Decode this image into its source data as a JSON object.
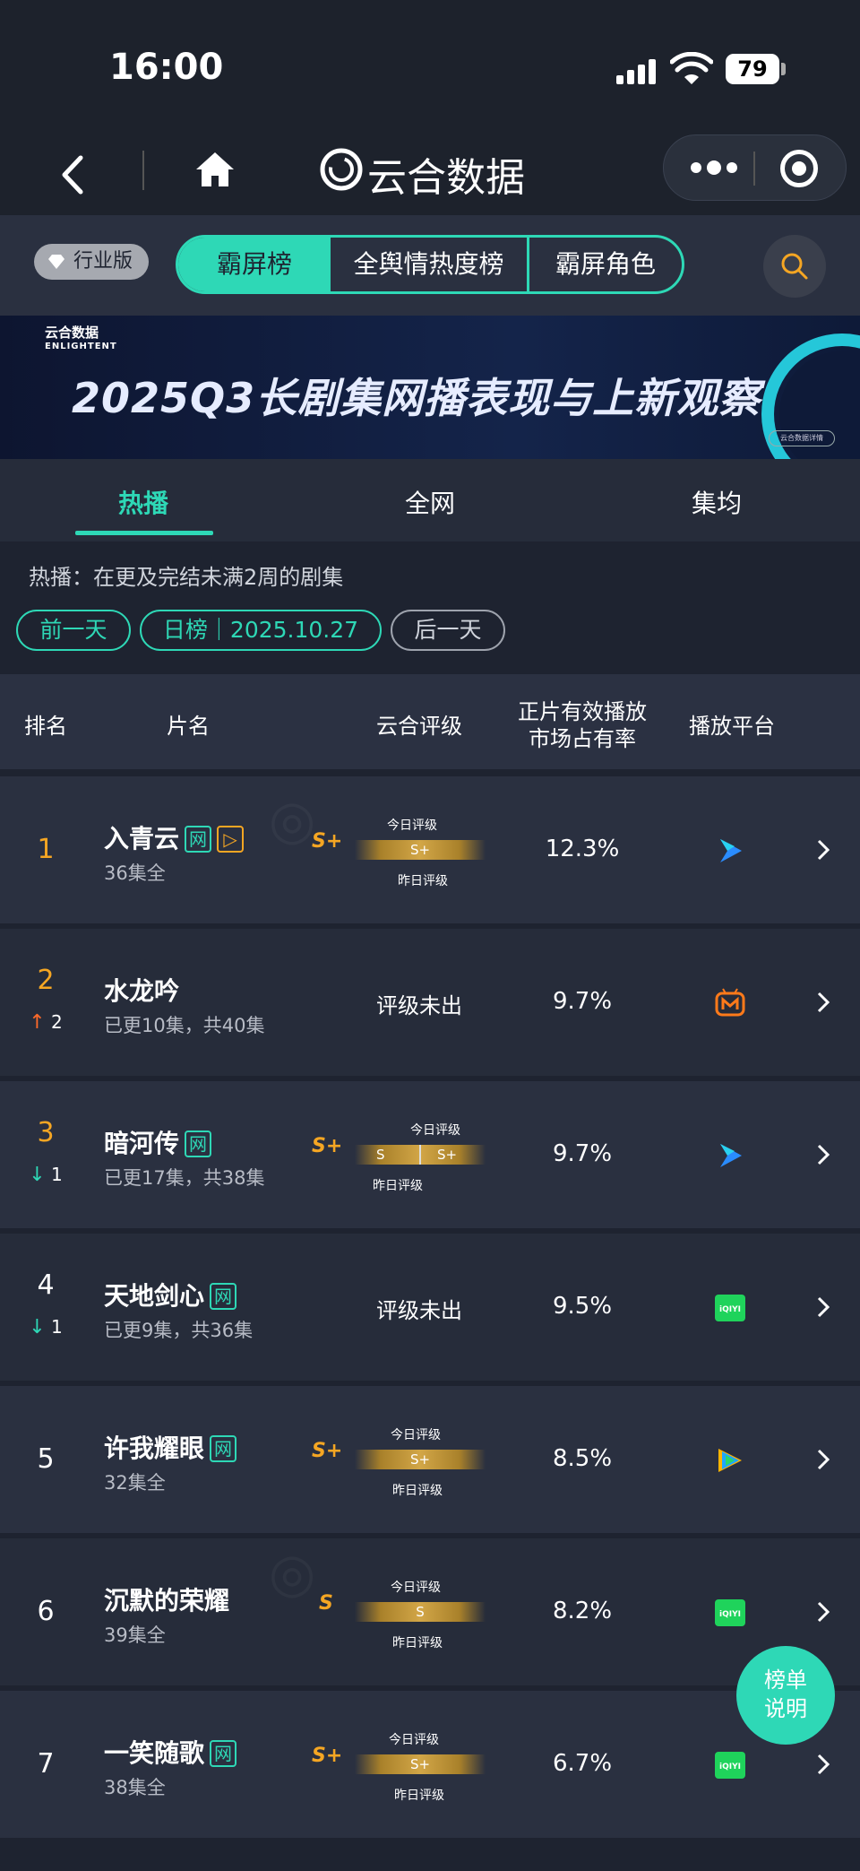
{
  "status": {
    "time": "16:00",
    "battery": "79"
  },
  "nav": {
    "brand": "云合数据"
  },
  "filter": {
    "edition_badge": "行业版",
    "segments": [
      "霸屏榜",
      "全舆情热度榜",
      "霸屏角色"
    ]
  },
  "banner": {
    "logo_text": "云合数据",
    "logo_sub": "ENLIGHTENT",
    "title": "2025Q3长剧集网播表现与上新观察",
    "chip": "云合数据详情"
  },
  "tabs": [
    "热播",
    "全网",
    "集均"
  ],
  "description": "热播：在更及完结未满2周的剧集",
  "date_nav": {
    "prev": "前一天",
    "current": "日榜｜2025.10.27",
    "next": "后一天"
  },
  "table": {
    "headers": {
      "rank": "排名",
      "title": "片名",
      "grade": "云合评级",
      "share_line1": "正片有效播放",
      "share_line2": "市场占有率",
      "platform": "播放平台"
    },
    "today_label": "今日评级",
    "yesterday_label": "昨日评级",
    "no_grade": "评级未出",
    "rows": [
      {
        "rank": "1",
        "change": "",
        "title": "入青云",
        "tags": [
          "网",
          "▷"
        ],
        "sub": "36集全",
        "grade": "S+",
        "today": "S+",
        "yesterday": "S+",
        "share": "12.3%",
        "platform": "youku"
      },
      {
        "rank": "2",
        "change": "2",
        "change_dir": "up",
        "title": "水龙吟",
        "tags": [],
        "sub": "已更10集，共40集",
        "grade": "",
        "share": "9.7%",
        "platform": "mgtv"
      },
      {
        "rank": "3",
        "change": "1",
        "change_dir": "down",
        "title": "暗河传",
        "tags": [
          "网"
        ],
        "sub": "已更17集，共38集",
        "grade": "S+",
        "today": "S+",
        "yesterday": "S",
        "share": "9.7%",
        "platform": "youku"
      },
      {
        "rank": "4",
        "change": "1",
        "change_dir": "down",
        "title": "天地剑心",
        "tags": [
          "网"
        ],
        "sub": "已更9集，共36集",
        "grade": "",
        "share": "9.5%",
        "platform": "iqiyi"
      },
      {
        "rank": "5",
        "change": "",
        "title": "许我耀眼",
        "tags": [
          "网"
        ],
        "sub": "32集全",
        "grade": "S+",
        "today": "S+",
        "yesterday": "S+",
        "share": "8.5%",
        "platform": "tencent"
      },
      {
        "rank": "6",
        "change": "",
        "title": "沉默的荣耀",
        "tags": [],
        "sub": "39集全",
        "grade": "S",
        "today": "S",
        "yesterday": "S",
        "share": "8.2%",
        "platform": "iqiyi"
      },
      {
        "rank": "7",
        "change": "",
        "title": "一笑随歌",
        "tags": [
          "网"
        ],
        "sub": "38集全",
        "grade": "S+",
        "today": "S+",
        "yesterday": "S+",
        "share": "6.7%",
        "platform": "iqiyi"
      }
    ]
  },
  "help_button": {
    "line1": "榜单",
    "line2": "说明"
  },
  "platform_labels": {
    "iqiyi": "iQIYI"
  },
  "colors": {
    "accent": "#2ed8b6",
    "gold": "#f5a623",
    "up": "#ff6a2a"
  }
}
